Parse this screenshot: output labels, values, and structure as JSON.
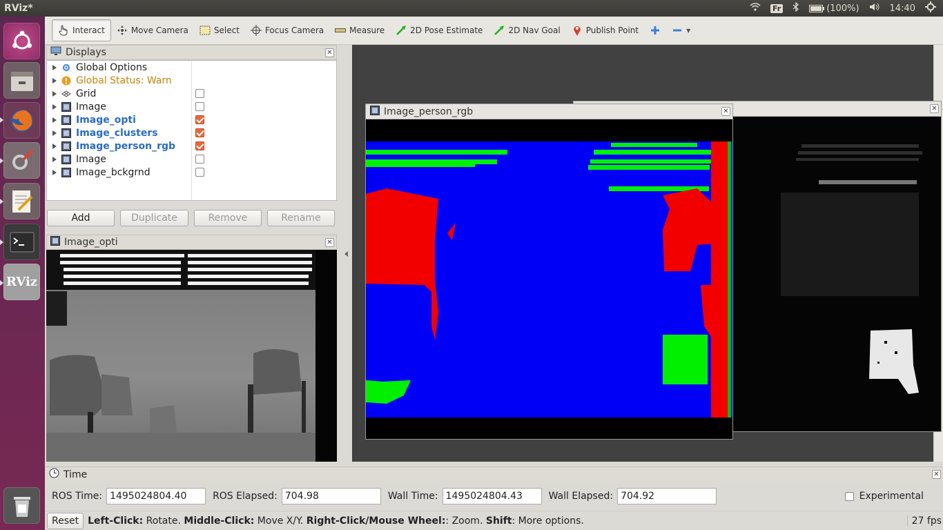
{
  "topbar": {
    "title": "RViz*",
    "keyboard": "Fr",
    "battery": "(100%)",
    "clock": "14:40"
  },
  "launcher": {
    "items": [
      "ubuntu-icon",
      "files-icon",
      "firefox-icon",
      "settings-icon",
      "text-editor-icon",
      "terminal-icon",
      "rviz-icon"
    ],
    "trash": "trash-icon",
    "rviz_label": "RViz"
  },
  "toolbar": {
    "tools": [
      "Interact",
      "Move Camera",
      "Select",
      "Focus Camera",
      "Measure",
      "2D Pose Estimate",
      "2D Nav Goal",
      "Publish Point"
    ]
  },
  "displays": {
    "title": "Displays",
    "items": [
      {
        "label": "Global Options",
        "checked": null
      },
      {
        "label": "Global Status: Warn",
        "checked": null
      },
      {
        "label": "Grid",
        "checked": false
      },
      {
        "label": "Image",
        "checked": false
      },
      {
        "label": "Image_opti",
        "checked": true
      },
      {
        "label": "Image_clusters",
        "checked": true
      },
      {
        "label": "Image_person_rgb",
        "checked": true
      },
      {
        "label": "Image",
        "checked": false
      },
      {
        "label": "Image_bckgrnd",
        "checked": false
      }
    ],
    "buttons": {
      "add": "Add",
      "duplicate": "Duplicate",
      "remove": "Remove",
      "rename": "Rename"
    }
  },
  "image_opti": {
    "title": "Image_opti"
  },
  "image_person": {
    "title": "Image_person_rgb"
  },
  "time": {
    "title": "Time",
    "ros_time_label": "ROS Time:",
    "ros_time": "1495024804.40",
    "ros_elapsed_label": "ROS Elapsed:",
    "ros_elapsed": "704.98",
    "wall_time_label": "Wall Time:",
    "wall_time": "1495024804.43",
    "wall_elapsed_label": "Wall Elapsed:",
    "wall_elapsed": "704.92",
    "experimental": "Experimental"
  },
  "status": {
    "reset": "Reset",
    "k1": "Left-Click:",
    "v1": " Rotate. ",
    "k2": "Middle-Click:",
    "v2": " Move X/Y. ",
    "k3": "Right-Click/Mouse Wheel:",
    "v3": ": Zoom. ",
    "k4": "Shift",
    "v4": ": More options.",
    "fps": "27 fps"
  },
  "colors": {
    "launcher": "#772953",
    "selected": "#2a6cc2",
    "warn": "#c4830c",
    "check": "#e9693e"
  }
}
